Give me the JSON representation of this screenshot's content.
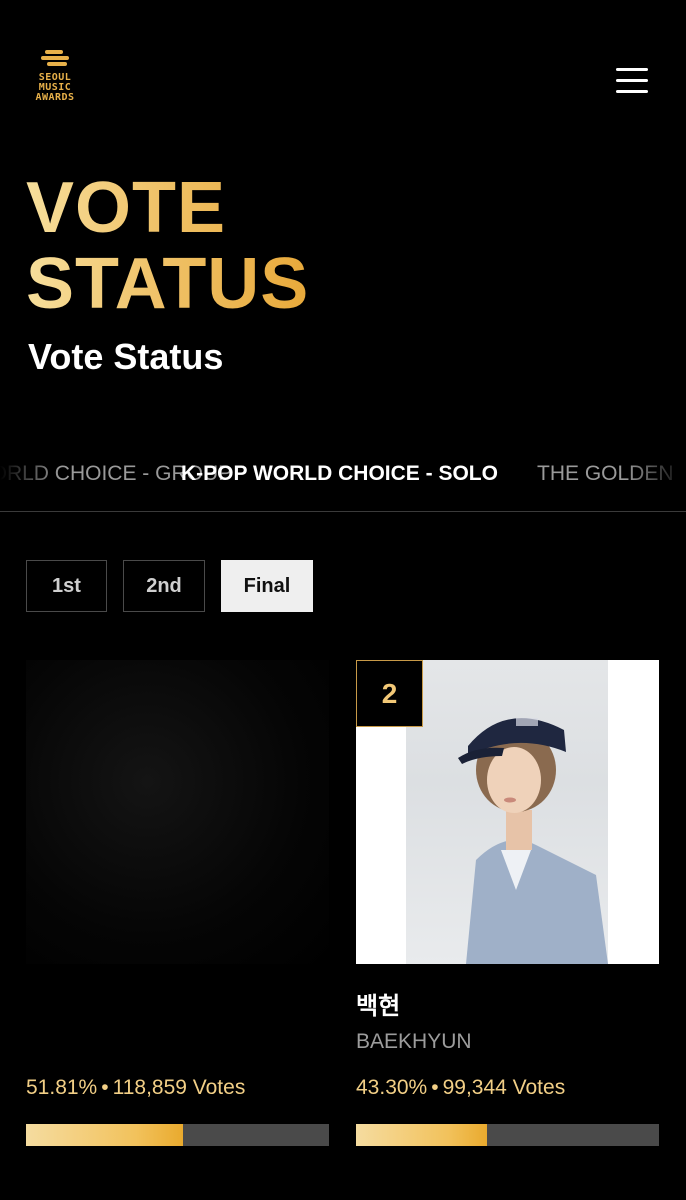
{
  "header": {
    "logo_lines": [
      "SEOUL",
      "MUSIC",
      "AWARDS"
    ],
    "menu_icon": "hamburger-menu-icon"
  },
  "hero": {
    "title_line1": "VOTE",
    "title_line2": "STATUS",
    "subtitle": "Vote Status"
  },
  "tabs": [
    {
      "label": "K-POP WORLD CHOICE - GROUP",
      "active": false
    },
    {
      "label": "K-POP WORLD CHOICE - SOLO",
      "active": true
    },
    {
      "label": "THE GOLDEN",
      "active": false
    }
  ],
  "rounds": [
    {
      "label": "1st",
      "active": false
    },
    {
      "label": "2nd",
      "active": false
    },
    {
      "label": "Final",
      "active": true
    }
  ],
  "candidates": [
    {
      "rank": "",
      "name_kr": "",
      "name_en": "",
      "percent": "51.81%",
      "votes": "118,859 Votes",
      "share": 0.5181
    },
    {
      "rank": "2",
      "name_kr": "백현",
      "name_en": "BAEKHYUN",
      "percent": "43.30%",
      "votes": "99,344 Votes",
      "share": 0.433
    }
  ],
  "colors": {
    "accent_gold": "#f2c25c",
    "background": "#000000",
    "bar_track": "#4a4a4a"
  }
}
